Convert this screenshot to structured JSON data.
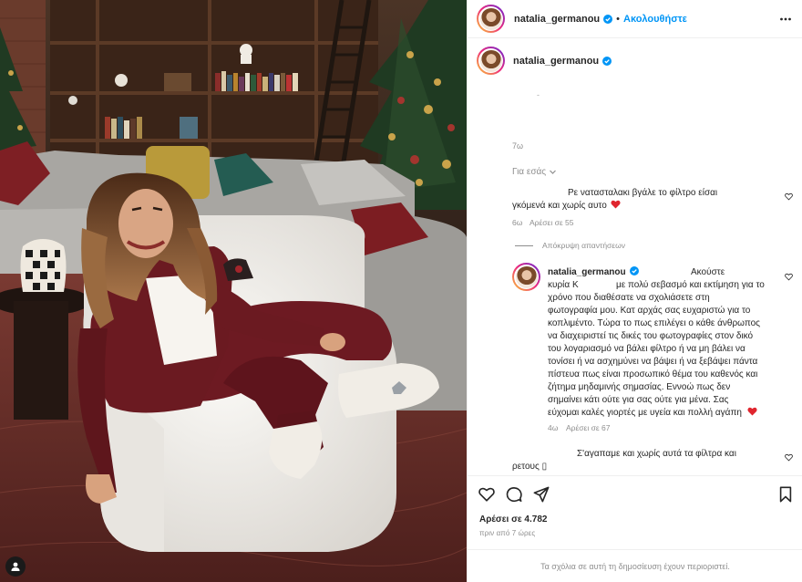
{
  "post": {
    "username": "natalia_germanou",
    "follow_label": "Ακολουθήστε",
    "separator": "•"
  },
  "caption": {
    "username": "natalia_germanou",
    "text_placeholder": "-",
    "time": "7ω",
    "for_you_label": "Για εσάς"
  },
  "comments": [
    {
      "text_line1": "Ρε νατασταλακι βγάλε το φίλτρο είσαι",
      "text_line2": "γκόμενά και χωρίς αυτο",
      "time": "6ω",
      "likes": "Αρέσει σε 55"
    }
  ],
  "hide_replies_label": "Απόκρυψη απαντήσεων",
  "reply": {
    "username": "natalia_germanou",
    "line1": "Ακούστε",
    "line2a": "κυρία Κ",
    "line2b": "με πολύ σεβασμό και εκτίμηση για το",
    "line3": "χρόνο που διαθέσατε να σχολιάσετε στη",
    "line4": "φωτογραφία μου. Κατ αρχάς σας ευχαριστώ για το",
    "line5": "κοπλιμέντο. Τώρα το πως επιλέγει ο κάθε άνθρωπος",
    "line6": "να διαχειριστεί τις δικές του φωτογραφίες στον δικό",
    "line7": "του λογαριασμό να βάλει φίλτρο ή να μη βάλει να",
    "line8": "τονίσει ή να ασχημύνει να βάψει ή να ξεβάψει πάντα",
    "line9": "πίστευα πως είναι προσωπικό θέμα του καθενός και",
    "line10": "ζήτημα μηδαμινής σημασίας. Εννοώ πως δεν",
    "line11": "σημαίνει κάτι ούτε για σας ούτε για μένα. Σας",
    "line12": "εύχομαι καλές γιορτές με υγεία και πολλή αγάπη",
    "time": "4ω",
    "likes": "Αρέσει σε 67"
  },
  "comment2": {
    "line1": "Σ'αγαπαμε και χωρίς αυτά τα φίλτρα και",
    "line2": "ρετους",
    "glyph": "▯"
  },
  "actions": {
    "likes": "Αρέσει σε 4.782",
    "posted": "πριν από 7 ώρες",
    "limited_notice": "Τα σχόλια σε αυτή τη δημοσίευση έχουν περιοριστεί."
  },
  "icons": [
    "more-icon",
    "verified-badge-icon",
    "heart-icon",
    "comment-icon",
    "share-icon",
    "bookmark-icon",
    "chevron-down-icon",
    "user-tag-icon"
  ],
  "colors": {
    "accent": "#0095f6",
    "heart_red": "#ed4956",
    "muted": "#8e8e8e",
    "text": "#262626"
  }
}
